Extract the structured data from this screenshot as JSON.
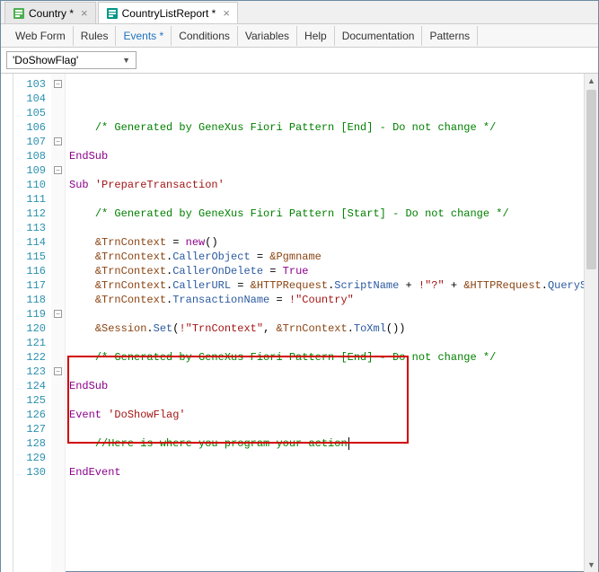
{
  "topTabs": [
    {
      "label": "Country *",
      "iconColor": "#4caf50",
      "active": false
    },
    {
      "label": "CountryListReport *",
      "iconColor": "#009688",
      "active": true
    }
  ],
  "subTabs": [
    {
      "label": "Web Form",
      "active": false
    },
    {
      "label": "Rules",
      "active": false
    },
    {
      "label": "Events *",
      "active": true
    },
    {
      "label": "Conditions",
      "active": false
    },
    {
      "label": "Variables",
      "active": false
    },
    {
      "label": "Help",
      "active": false
    },
    {
      "label": "Documentation",
      "active": false
    },
    {
      "label": "Patterns",
      "active": false
    }
  ],
  "dropdown": {
    "label": "'DoShowFlag'"
  },
  "lines": [
    {
      "n": 103,
      "fold": "box",
      "tokens": [
        [
          "    ",
          ""
        ],
        [
          "/* Generated by GeneXus Fiori Pattern [End] - Do not change */",
          "comment"
        ]
      ]
    },
    {
      "n": 104,
      "fold": "",
      "tokens": []
    },
    {
      "n": 105,
      "fold": "end",
      "tokens": [
        [
          "EndSub",
          "keyword"
        ]
      ]
    },
    {
      "n": 106,
      "fold": "",
      "tokens": []
    },
    {
      "n": 107,
      "fold": "box",
      "tokens": [
        [
          "Sub ",
          "keyword"
        ],
        [
          "'PrepareTransaction'",
          "string"
        ]
      ]
    },
    {
      "n": 108,
      "fold": "",
      "tokens": []
    },
    {
      "n": 109,
      "fold": "box",
      "tokens": [
        [
          "    ",
          ""
        ],
        [
          "/* Generated by GeneXus Fiori Pattern [Start] - Do not change */",
          "comment"
        ]
      ]
    },
    {
      "n": 110,
      "fold": "",
      "tokens": []
    },
    {
      "n": 111,
      "fold": "",
      "tokens": [
        [
          "    ",
          ""
        ],
        [
          "&TrnContext",
          "var"
        ],
        [
          " = ",
          "op"
        ],
        [
          "new",
          "keyword"
        ],
        [
          "()",
          "op"
        ]
      ]
    },
    {
      "n": 112,
      "fold": "",
      "tokens": [
        [
          "    ",
          ""
        ],
        [
          "&TrnContext",
          "var"
        ],
        [
          ".",
          "op"
        ],
        [
          "CallerObject",
          "ident"
        ],
        [
          " = ",
          "op"
        ],
        [
          "&Pgmname",
          "var"
        ]
      ]
    },
    {
      "n": 113,
      "fold": "",
      "tokens": [
        [
          "    ",
          ""
        ],
        [
          "&TrnContext",
          "var"
        ],
        [
          ".",
          "op"
        ],
        [
          "CallerOnDelete",
          "ident"
        ],
        [
          " = ",
          "op"
        ],
        [
          "True",
          "keyword"
        ]
      ]
    },
    {
      "n": 114,
      "fold": "",
      "tokens": [
        [
          "    ",
          ""
        ],
        [
          "&TrnContext",
          "var"
        ],
        [
          ".",
          "op"
        ],
        [
          "CallerURL",
          "ident"
        ],
        [
          " = ",
          "op"
        ],
        [
          "&HTTPRequest",
          "var"
        ],
        [
          ".",
          "op"
        ],
        [
          "ScriptName",
          "ident"
        ],
        [
          " + ",
          "op"
        ],
        [
          "!\"?\"",
          "string"
        ],
        [
          " + ",
          "op"
        ],
        [
          "&HTTPRequest",
          "var"
        ],
        [
          ".",
          "op"
        ],
        [
          "QueryString",
          "ident"
        ]
      ]
    },
    {
      "n": 115,
      "fold": "",
      "tokens": [
        [
          "    ",
          ""
        ],
        [
          "&TrnContext",
          "var"
        ],
        [
          ".",
          "op"
        ],
        [
          "TransactionName",
          "ident"
        ],
        [
          " = ",
          "op"
        ],
        [
          "!\"Country\"",
          "string"
        ]
      ]
    },
    {
      "n": 116,
      "fold": "",
      "tokens": []
    },
    {
      "n": 117,
      "fold": "",
      "tokens": [
        [
          "    ",
          ""
        ],
        [
          "&Session",
          "var"
        ],
        [
          ".",
          "op"
        ],
        [
          "Set",
          "ident"
        ],
        [
          "(",
          "op"
        ],
        [
          "!\"TrnContext\"",
          "string"
        ],
        [
          ", ",
          "op"
        ],
        [
          "&TrnContext",
          "var"
        ],
        [
          ".",
          "op"
        ],
        [
          "ToXml",
          "ident"
        ],
        [
          "())",
          "op"
        ]
      ]
    },
    {
      "n": 118,
      "fold": "",
      "tokens": []
    },
    {
      "n": 119,
      "fold": "box",
      "tokens": [
        [
          "    ",
          ""
        ],
        [
          "/* Generated by GeneXus Fiori Pattern [End] - Do not change */",
          "comment"
        ]
      ]
    },
    {
      "n": 120,
      "fold": "",
      "tokens": []
    },
    {
      "n": 121,
      "fold": "end",
      "tokens": [
        [
          "EndSub",
          "keyword"
        ]
      ]
    },
    {
      "n": 122,
      "fold": "",
      "tokens": []
    },
    {
      "n": 123,
      "fold": "box",
      "tokens": [
        [
          "Event ",
          "keyword"
        ],
        [
          "'DoShowFlag'",
          "string"
        ]
      ]
    },
    {
      "n": 124,
      "fold": "",
      "tokens": []
    },
    {
      "n": 125,
      "fold": "",
      "tokens": [
        [
          "    ",
          ""
        ],
        [
          "//Here is where you program your action",
          "comment"
        ]
      ],
      "caret": true
    },
    {
      "n": 126,
      "fold": "",
      "tokens": []
    },
    {
      "n": 127,
      "fold": "end",
      "tokens": [
        [
          "EndEvent",
          "keyword"
        ]
      ]
    },
    {
      "n": 128,
      "fold": "",
      "tokens": []
    },
    {
      "n": 129,
      "fold": "",
      "tokens": []
    },
    {
      "n": 130,
      "fold": "",
      "tokens": []
    }
  ],
  "highlight": {
    "topLine": 122,
    "bottomLine": 128
  }
}
